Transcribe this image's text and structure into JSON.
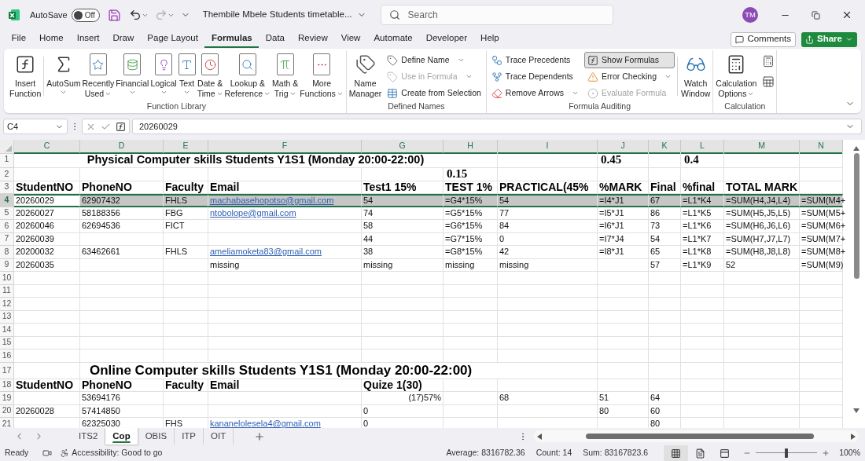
{
  "title_bar": {
    "autosave_label": "AutoSave",
    "autosave": {
      "on": false,
      "label": "Off"
    },
    "document_title": "Thembile Mbele Students timetable...",
    "search": {
      "placeholder": "Search"
    },
    "avatar": "TM"
  },
  "menu_tabs": [
    {
      "label": "File",
      "selected": false
    },
    {
      "label": "Home",
      "selected": false
    },
    {
      "label": "Insert",
      "selected": false
    },
    {
      "label": "Draw",
      "selected": false
    },
    {
      "label": "Page Layout",
      "selected": false
    },
    {
      "label": "Formulas",
      "selected": true
    },
    {
      "label": "Data",
      "selected": false
    },
    {
      "label": "Review",
      "selected": false
    },
    {
      "label": "View",
      "selected": false
    },
    {
      "label": "Automate",
      "selected": false
    },
    {
      "label": "Developer",
      "selected": false
    },
    {
      "label": "Help",
      "selected": false
    }
  ],
  "comments_button": "Comments",
  "share_button": "Share",
  "ribbon_groups": [
    {
      "kind": "function_library",
      "label": "Function Library",
      "buttons": [
        {
          "lines": [
            "Insert",
            "Function"
          ],
          "dropdown": false
        },
        {
          "lines": [
            "AutoSum"
          ],
          "dropdown": true
        },
        {
          "lines": [
            "Recently",
            "Used"
          ],
          "dropdown": true
        },
        {
          "lines": [
            "Financial"
          ],
          "dropdown": true
        },
        {
          "lines": [
            "Logical"
          ],
          "dropdown": true
        },
        {
          "lines": [
            "Text"
          ],
          "dropdown": true
        },
        {
          "lines": [
            "Date &",
            "Time"
          ],
          "dropdown": true
        },
        {
          "lines": [
            "Lookup &",
            "Reference"
          ],
          "dropdown": true
        },
        {
          "lines": [
            "Math &",
            "Trig"
          ],
          "dropdown": true
        },
        {
          "lines": [
            "More",
            "Functions"
          ],
          "dropdown": true
        }
      ]
    },
    {
      "kind": "defined_names",
      "label": "Defined Names",
      "buttons": [
        {
          "lines": [
            "Name",
            "Manager"
          ],
          "dropdown": false
        }
      ],
      "small_buttons": [
        {
          "label": "Define Name",
          "dropdown": true,
          "disabled": false,
          "on": false
        },
        {
          "label": "Use in Formula",
          "dropdown": true,
          "disabled": true,
          "on": false
        },
        {
          "label": "Create from Selection",
          "dropdown": false,
          "disabled": false,
          "on": false
        }
      ]
    },
    {
      "kind": "formula_auditing",
      "label": "Formula Auditing",
      "buttons": [
        {
          "lines": [
            "Watch",
            "Window"
          ],
          "dropdown": false
        }
      ],
      "small_buttons": [
        {
          "label": "Trace Precedents",
          "dropdown": false,
          "disabled": false,
          "on": false
        },
        {
          "label": "Trace Dependents",
          "dropdown": false,
          "disabled": false,
          "on": false
        },
        {
          "label": "Remove Arrows",
          "dropdown": true,
          "disabled": false,
          "on": false
        },
        {
          "label": "Show Formulas",
          "dropdown": false,
          "disabled": false,
          "on": true
        },
        {
          "label": "Error Checking",
          "dropdown": true,
          "disabled": false,
          "on": false
        },
        {
          "label": "Evaluate Formula",
          "dropdown": false,
          "disabled": true,
          "on": false
        }
      ]
    },
    {
      "kind": "calculation",
      "label": "Calculation",
      "buttons": [
        {
          "lines": [
            "Calculation",
            "Options"
          ],
          "dropdown": true
        }
      ]
    }
  ],
  "formula_bar": {
    "name_box": "C4",
    "value": "20260029"
  },
  "columns": [
    {
      "label": "C",
      "selected": true
    },
    {
      "label": "D",
      "selected": true
    },
    {
      "label": "E",
      "selected": true
    },
    {
      "label": "F",
      "selected": true
    },
    {
      "label": "G",
      "selected": true
    },
    {
      "label": "H",
      "selected": true
    },
    {
      "label": "I",
      "selected": true
    },
    {
      "label": "J",
      "selected": true
    },
    {
      "label": "K",
      "selected": true
    },
    {
      "label": "L",
      "selected": true
    },
    {
      "label": "M",
      "selected": true
    },
    {
      "label": "N",
      "selected": true
    }
  ],
  "rows": [
    {
      "label": "1",
      "selected": false,
      "cells": {
        "C": {
          "kind": "title",
          "text": "Physical Computer skills Students Y1S1 (Monday 20:00-22:00)"
        },
        "J": {
          "kind": "big",
          "text": "0.45"
        },
        "L": {
          "kind": "big",
          "text": "0.4"
        }
      }
    },
    {
      "label": "2",
      "selected": false,
      "cells": {
        "H": {
          "kind": "big",
          "text": "0.15"
        }
      }
    },
    {
      "label": "3",
      "selected": false,
      "cells": {
        "C": {
          "kind": "header",
          "text": "StudentNO"
        },
        "D": {
          "kind": "header",
          "text": "PhoneNO"
        },
        "E": {
          "kind": "header",
          "text": "Faculty"
        },
        "F": {
          "kind": "header",
          "text": "Email"
        },
        "G": {
          "kind": "header",
          "text": "Test1 15%"
        },
        "H": {
          "kind": "header",
          "text": "TEST 1%"
        },
        "I": {
          "kind": "header",
          "text": "PRACTICAL(45%"
        },
        "J": {
          "kind": "header",
          "text": "%MARK"
        },
        "K": {
          "kind": "header",
          "text": "Final"
        },
        "L": {
          "kind": "header",
          "text": "%final"
        },
        "M": {
          "kind": "header",
          "text": "TOTAL MARK"
        }
      }
    },
    {
      "label": "4",
      "selected": true,
      "cells": {
        "C": {
          "kind": "text",
          "text": "20260029"
        },
        "D": {
          "kind": "text",
          "text": "62907432"
        },
        "E": {
          "kind": "text",
          "text": "FHLS"
        },
        "F": {
          "kind": "link",
          "text": "machabasehopotso@gmail.com"
        },
        "G": {
          "kind": "text",
          "text": "54"
        },
        "H": {
          "kind": "text",
          "text": "=G4*15%"
        },
        "I": {
          "kind": "text",
          "text": "54"
        },
        "J": {
          "kind": "text",
          "text": "=I4*J1"
        },
        "K": {
          "kind": "text",
          "text": "67"
        },
        "L": {
          "kind": "text",
          "text": "=L1*K4"
        },
        "M": {
          "kind": "text",
          "text": "=SUM(H4,J4,L4)"
        },
        "N": {
          "kind": "text",
          "text": "=SUM(M4+"
        }
      }
    },
    {
      "label": "5",
      "selected": false,
      "cells": {
        "C": {
          "kind": "text",
          "text": "20260027"
        },
        "D": {
          "kind": "text",
          "text": "58188356"
        },
        "E": {
          "kind": "text",
          "text": "FBG"
        },
        "F": {
          "kind": "link",
          "text": "ntobolope@gmail.com"
        },
        "G": {
          "kind": "text",
          "text": "74"
        },
        "H": {
          "kind": "text",
          "text": "=G5*15%"
        },
        "I": {
          "kind": "text",
          "text": "77"
        },
        "J": {
          "kind": "text",
          "text": "=I5*J1"
        },
        "K": {
          "kind": "text",
          "text": "86"
        },
        "L": {
          "kind": "text",
          "text": "=L1*K5"
        },
        "M": {
          "kind": "text",
          "text": "=SUM(H5,J5,L5)"
        },
        "N": {
          "kind": "text",
          "text": "=SUM(M5+"
        }
      }
    },
    {
      "label": "6",
      "selected": false,
      "cells": {
        "C": {
          "kind": "text",
          "text": "20260046"
        },
        "D": {
          "kind": "text",
          "text": "62694536"
        },
        "E": {
          "kind": "text",
          "text": "FICT"
        },
        "G": {
          "kind": "text",
          "text": "58"
        },
        "H": {
          "kind": "text",
          "text": "=G6*15%"
        },
        "I": {
          "kind": "text",
          "text": "84"
        },
        "J": {
          "kind": "text",
          "text": "=I6*J1"
        },
        "K": {
          "kind": "text",
          "text": "73"
        },
        "L": {
          "kind": "text",
          "text": "=L1*K6"
        },
        "M": {
          "kind": "text",
          "text": "=SUM(H6,J6,L6)"
        },
        "N": {
          "kind": "text",
          "text": "=SUM(M6+"
        }
      }
    },
    {
      "label": "7",
      "selected": false,
      "cells": {
        "C": {
          "kind": "text",
          "text": "20260039"
        },
        "G": {
          "kind": "text",
          "text": "44"
        },
        "H": {
          "kind": "text",
          "text": "=G7*15%"
        },
        "I": {
          "kind": "text",
          "text": "0"
        },
        "J": {
          "kind": "text",
          "text": "=I7*J4"
        },
        "K": {
          "kind": "text",
          "text": "54"
        },
        "L": {
          "kind": "text",
          "text": "=L1*K7"
        },
        "M": {
          "kind": "text",
          "text": "=SUM(H7,J7,L7)"
        },
        "N": {
          "kind": "text",
          "text": "=SUM(M7+"
        }
      }
    },
    {
      "label": "8",
      "selected": false,
      "cells": {
        "C": {
          "kind": "text",
          "text": "20200032"
        },
        "D": {
          "kind": "text",
          "text": "63462661"
        },
        "E": {
          "kind": "text",
          "text": "FHLS"
        },
        "F": {
          "kind": "link",
          "text": "ameliamoketa83@gmail.com"
        },
        "G": {
          "kind": "text",
          "text": "38"
        },
        "H": {
          "kind": "text",
          "text": "=G8*15%"
        },
        "I": {
          "kind": "text",
          "text": "42"
        },
        "J": {
          "kind": "text",
          "text": "=I8*J1"
        },
        "K": {
          "kind": "text",
          "text": "65"
        },
        "L": {
          "kind": "text",
          "text": "=L1*K8"
        },
        "M": {
          "kind": "text",
          "text": "=SUM(H8,J8,L8)"
        },
        "N": {
          "kind": "text",
          "text": "=SUM(M8+"
        }
      }
    },
    {
      "label": "9",
      "selected": false,
      "cells": {
        "C": {
          "kind": "text",
          "text": "20260035"
        },
        "F": {
          "kind": "text",
          "text": "missing"
        },
        "G": {
          "kind": "text",
          "text": "missing"
        },
        "H": {
          "kind": "text",
          "text": "missing"
        },
        "I": {
          "kind": "text",
          "text": "missing"
        },
        "K": {
          "kind": "text",
          "text": "57"
        },
        "L": {
          "kind": "text",
          "text": "=L1*K9"
        },
        "M": {
          "kind": "text",
          "text": "52"
        },
        "N": {
          "kind": "text",
          "text": "=SUM(M9)"
        }
      }
    },
    {
      "label": "10",
      "selected": false
    },
    {
      "label": "11",
      "selected": false
    },
    {
      "label": "12",
      "selected": false
    },
    {
      "label": "13",
      "selected": false
    },
    {
      "label": "14",
      "selected": false
    },
    {
      "label": "15",
      "selected": false
    },
    {
      "label": "16",
      "selected": false
    },
    {
      "label": "17",
      "selected": false,
      "cells": {
        "D": {
          "kind": "title_large",
          "text": "Online Computer skills Students Y1S1 (Monday 20:00-22:00)"
        }
      }
    },
    {
      "label": "18",
      "selected": false,
      "cells": {
        "C": {
          "kind": "header",
          "text": "StudentNO"
        },
        "D": {
          "kind": "header",
          "text": "PhoneNO"
        },
        "E": {
          "kind": "header",
          "text": "Faculty"
        },
        "F": {
          "kind": "header",
          "text": "Email"
        },
        "G": {
          "kind": "header",
          "text": "Quize 1(30)"
        }
      }
    },
    {
      "label": "19",
      "selected": false,
      "cells": {
        "D": {
          "kind": "text",
          "text": "53694176"
        },
        "G": {
          "kind": "right",
          "text": "(17)57%"
        },
        "I": {
          "kind": "text",
          "text": "68"
        },
        "J": {
          "kind": "text",
          "text": "51"
        },
        "K": {
          "kind": "text",
          "text": "64"
        }
      }
    },
    {
      "label": "20",
      "selected": false,
      "cells": {
        "C": {
          "kind": "text",
          "text": "20260028"
        },
        "D": {
          "kind": "text",
          "text": "57414850"
        },
        "G": {
          "kind": "text",
          "text": "0"
        },
        "J": {
          "kind": "text",
          "text": "80"
        },
        "K": {
          "kind": "text",
          "text": "60"
        }
      }
    },
    {
      "label": "21",
      "selected": false,
      "cells": {
        "D": {
          "kind": "text",
          "text": "62325030"
        },
        "E": {
          "kind": "text",
          "text": "FHS"
        },
        "F": {
          "kind": "link",
          "text": "kananelolesela4@gmail.com"
        },
        "G": {
          "kind": "text",
          "text": "0"
        },
        "K": {
          "kind": "text",
          "text": "80"
        }
      }
    }
  ],
  "sheet_tabs": [
    {
      "label": "ITS2",
      "selected": false
    },
    {
      "label": "Cop",
      "selected": true
    },
    {
      "label": "OBIS",
      "selected": false
    },
    {
      "label": "ITP",
      "selected": false
    },
    {
      "label": "OIT",
      "selected": false
    }
  ],
  "status_bar": {
    "mode": "Ready",
    "accessibility": "Accessibility: Good to go",
    "stats": [
      "Average: 8316782.36",
      "Count: 14",
      "Sum: 83167823.6"
    ],
    "views": [
      {
        "selected": true
      },
      {
        "selected": false
      },
      {
        "selected": false
      }
    ],
    "zoom": {
      "level": 0.5,
      "label": "100%"
    }
  }
}
